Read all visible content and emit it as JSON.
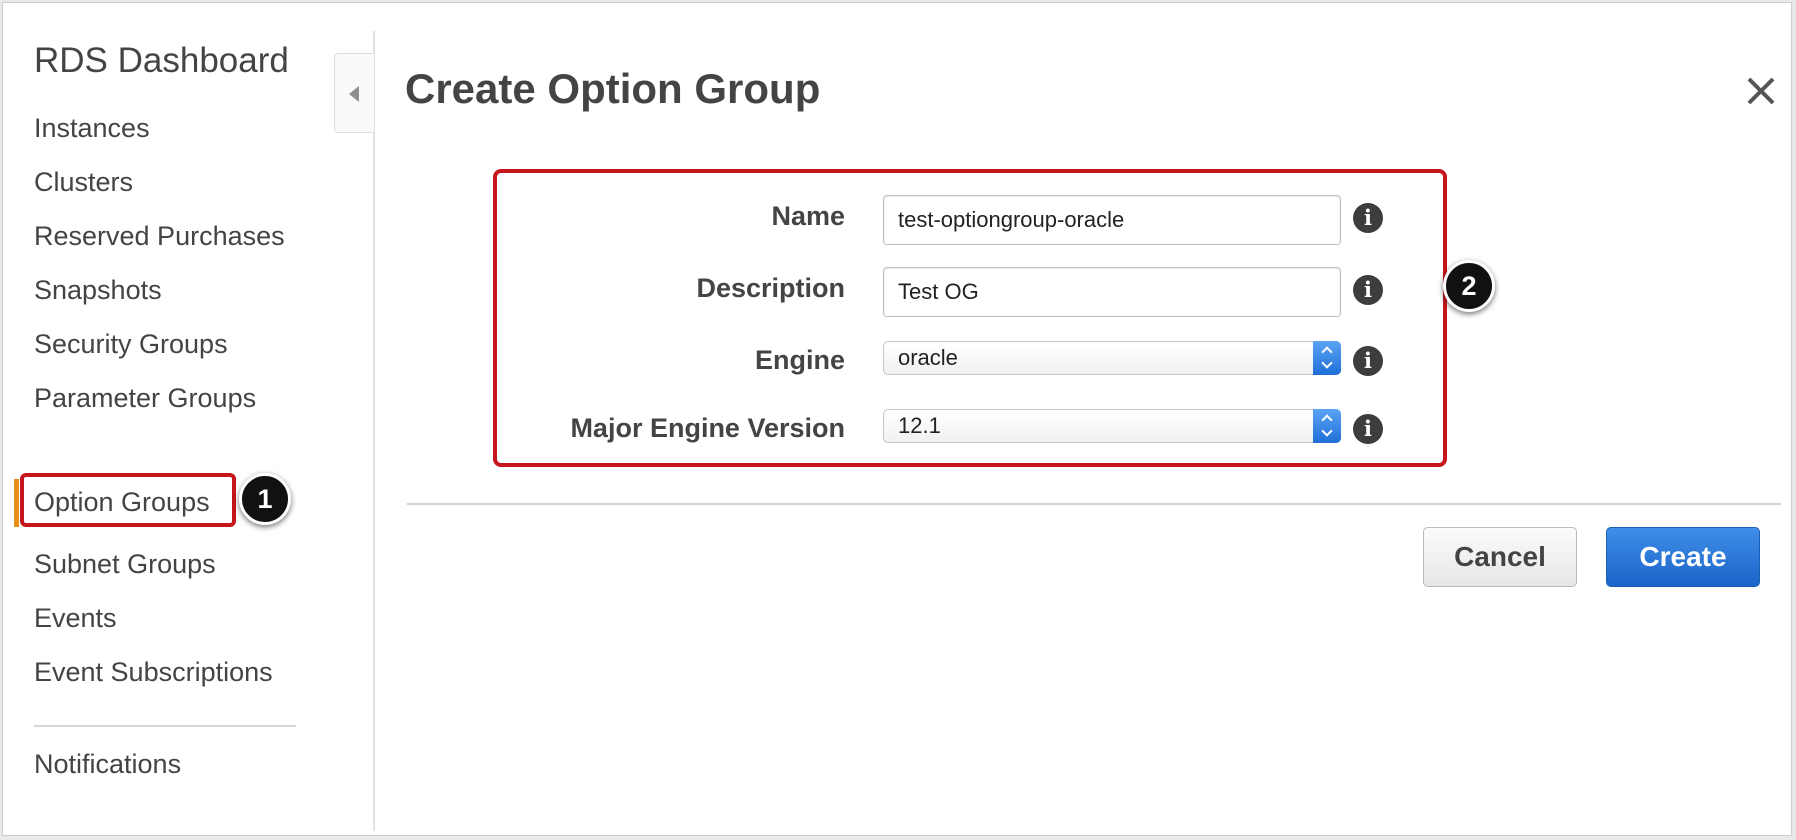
{
  "sidebar": {
    "title": "RDS Dashboard",
    "items": [
      {
        "label": "Instances"
      },
      {
        "label": "Clusters"
      },
      {
        "label": "Reserved Purchases"
      },
      {
        "label": "Snapshots"
      },
      {
        "label": "Security Groups"
      },
      {
        "label": "Parameter Groups"
      },
      {
        "label": "Option Groups",
        "active": true
      },
      {
        "label": "Subnet Groups"
      },
      {
        "label": "Events"
      },
      {
        "label": "Event Subscriptions"
      }
    ],
    "footer_items": [
      {
        "label": "Notifications"
      }
    ]
  },
  "callouts": [
    "1",
    "2"
  ],
  "dialog": {
    "title": "Create Option Group",
    "fields": {
      "name": {
        "label": "Name",
        "value": "test-optiongroup-oracle"
      },
      "description": {
        "label": "Description",
        "value": "Test OG"
      },
      "engine": {
        "label": "Engine",
        "value": "oracle"
      },
      "major_engine_version": {
        "label": "Major Engine Version",
        "value": "12.1"
      }
    },
    "info_glyph": "i",
    "buttons": {
      "cancel": "Cancel",
      "create": "Create"
    }
  },
  "colors": {
    "highlight": "#c4161c",
    "active_nav_accent": "#e88f1a",
    "primary_button": "#1b64c9"
  },
  "icons": [
    "collapse-left-icon",
    "close-icon",
    "info-icon",
    "select-arrows-icon"
  ]
}
